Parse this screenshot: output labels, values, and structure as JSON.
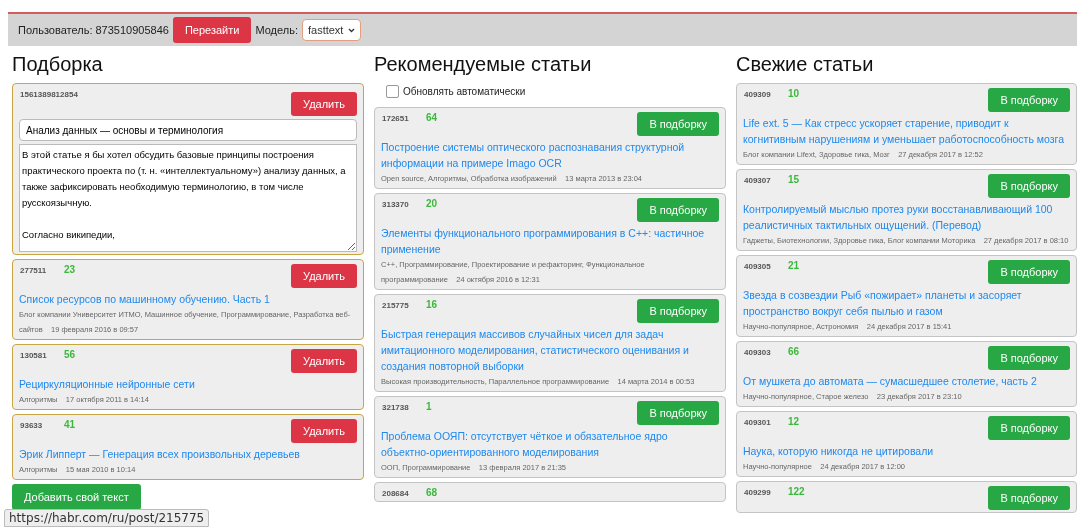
{
  "topbar": {
    "user_label": "Пользователь: 873510905846",
    "relogin_button": "Перезайти",
    "model_label": "Модель:",
    "model_select": "fasttext"
  },
  "selection": {
    "heading": "Подборка",
    "custom": {
      "id": "1561389812854",
      "button": "Удалить",
      "title": "Анализ данных — основы и терминология",
      "body": "В этой статье я бы хотел обсудить базовые принципы построения практического проекта по (т. н. «интеллектуальному») анализу данных, а также зафиксировать необходимую терминологию, в том числе русскоязычную.\n\nСогласно википедии,"
    },
    "articles": [
      {
        "id": "277511",
        "score": "23",
        "button": "Удалить",
        "title": "Список ресурсов по машинному обучению. Часть 1",
        "tags": "Блог компании Университет ИТМО, Машинное обучение, Программирование, Разработка веб-сайтов",
        "date": "19 февраля 2016 в 09:57"
      },
      {
        "id": "130581",
        "score": "56",
        "button": "Удалить",
        "title": "Рециркуляционные нейронные сети",
        "tags": "Алгоритмы",
        "date": "17 октября 2011 в 14:14"
      },
      {
        "id": "93633",
        "score": "41",
        "button": "Удалить",
        "title": "Эрик Липперт — Генерация всех произвольных деревьев",
        "tags": "Алгоритмы",
        "date": "15 мая 2010 в 10:14"
      }
    ],
    "add_button": "Добавить свой текст"
  },
  "recommended": {
    "heading": "Рекомендуемые статьи",
    "auto_update": {
      "label": "Обновлять автоматически",
      "checked": false
    },
    "articles": [
      {
        "id": "172651",
        "score": "64",
        "button": "В подборку",
        "title": "Построение системы оптического распознавания структурной информации на примере Imago OCR",
        "tags": "Open source, Алгоритмы, Обработка изображений",
        "date": "13 марта 2013 в 23:04"
      },
      {
        "id": "313370",
        "score": "20",
        "button": "В подборку",
        "title": "Элементы функционального программирования в C++: частичное применение",
        "tags": "C++, Программирование, Проектирование и рефакторинг, Функциональное программирование",
        "date": "24 октября 2016 в 12:31"
      },
      {
        "id": "215775",
        "score": "16",
        "button": "В подборку",
        "title": "Быстрая генерация массивов случайных чисел для задач имитационного моделирования, статистического оценивания и создания повторной выборки",
        "tags": "Высокая производительность, Параллельное программирование",
        "date": "14 марта 2014 в 00:53"
      },
      {
        "id": "321738",
        "score": "1",
        "button": "В подборку",
        "title": "Проблема ООЯП: отсутствует чёткое и обязательное ядро объектно-ориентированного моделирования",
        "tags": "ООП, Программирование",
        "date": "13 февраля 2017 в 21:35"
      },
      {
        "id": "208684",
        "score": "68"
      }
    ]
  },
  "fresh": {
    "heading": "Свежие статьи",
    "articles": [
      {
        "id": "409309",
        "score": "10",
        "button": "В подборку",
        "title": "Life ext. 5 — Как стресс ускоряет старение, приводит к когнитивным нарушениям и уменьшает работоспособность мозга",
        "tags": "Блог компании Lifext, Здоровье гика, Мозг",
        "date": "27 декабря 2017 в 12:52"
      },
      {
        "id": "409307",
        "score": "15",
        "button": "В подборку",
        "title": "Контролируемый мыслью протез руки восстанавливающий 100 реалистичных тактильных ощущений. (Перевод)",
        "tags": "Гаджеты, Биотехнологии, Здоровье гика, Блог компании Моторика",
        "date": "27 декабря 2017 в 08:10"
      },
      {
        "id": "409305",
        "score": "21",
        "button": "В подборку",
        "title": "Звезда в созвездии Рыб «пожирает» планеты и засоряет пространство вокруг себя пылью и газом",
        "tags": "Научно-популярное, Астрономия",
        "date": "24 декабря 2017 в 15:41"
      },
      {
        "id": "409303",
        "score": "66",
        "button": "В подборку",
        "title": "От мушкета до автомата — сумасшедшее столетие, часть 2",
        "tags": "Научно-популярное, Старое железо",
        "date": "23 декабря 2017 в 23:10"
      },
      {
        "id": "409301",
        "score": "12",
        "button": "В подборку",
        "title": "Наука, которую никогда не цитировали",
        "tags": "Научно-популярное",
        "date": "24 декабря 2017 в 12:00"
      },
      {
        "id": "409299",
        "score": "122",
        "button": "В подборку"
      }
    ]
  },
  "status_url": "https://habr.com/ru/post/215775"
}
